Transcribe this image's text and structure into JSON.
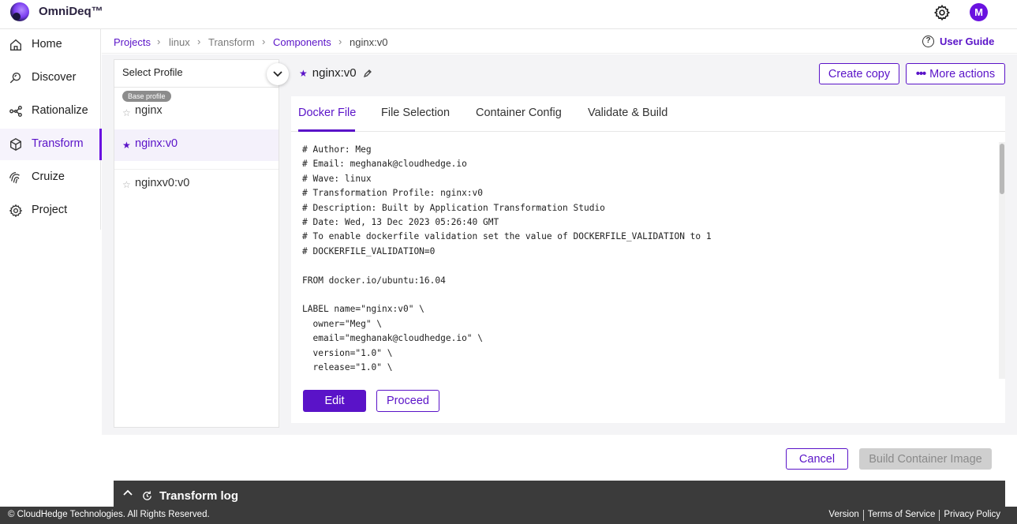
{
  "app": {
    "title": "OmniDeq™",
    "avatar_initial": "M"
  },
  "sidebar": {
    "items": [
      {
        "label": "Home",
        "icon": "home-icon"
      },
      {
        "label": "Discover",
        "icon": "discover-icon"
      },
      {
        "label": "Rationalize",
        "icon": "rationalize-icon"
      },
      {
        "label": "Transform",
        "icon": "cube-icon",
        "active": true
      },
      {
        "label": "Cruize",
        "icon": "fingerprint-icon"
      },
      {
        "label": "Project",
        "icon": "gear-icon"
      }
    ]
  },
  "breadcrumb": {
    "items": [
      "Projects",
      "linux",
      "Transform",
      "Components",
      "nginx:v0"
    ]
  },
  "user_guide": "User Guide",
  "profile_panel": {
    "header": "Select Profile",
    "base_badge": "Base profile",
    "profiles": [
      {
        "name": "nginx",
        "starred": false
      },
      {
        "name": "nginx:v0",
        "starred": true,
        "selected": true
      },
      {
        "name": "nginxv0:v0",
        "starred": false
      }
    ]
  },
  "detail": {
    "title": "nginx:v0",
    "create_copy": "Create copy",
    "more_actions": "More actions"
  },
  "tabs": [
    "Docker File",
    "File Selection",
    "Container Config",
    "Validate & Build"
  ],
  "dockerfile": {
    "lines": [
      "# Author: Meg",
      "# Email: meghanak@cloudhedge.io",
      "# Wave: linux",
      "# Transformation Profile: nginx:v0",
      "# Description: Built by Application Transformation Studio",
      "# Date: Wed, 13 Dec 2023 05:26:40 GMT",
      "# To enable dockerfile validation set the value of DOCKERFILE_VALIDATION to 1",
      "# DOCKERFILE_VALIDATION=0",
      "",
      "FROM docker.io/ubuntu:16.04",
      "",
      "LABEL name=\"nginx:v0\" \\",
      "  owner=\"Meg\" \\",
      "  email=\"meghanak@cloudhedge.io\" \\",
      "  version=\"1.0\" \\",
      "  release=\"1.0\" \\"
    ]
  },
  "actions": {
    "edit": "Edit",
    "proceed": "Proceed",
    "cancel": "Cancel",
    "build": "Build Container Image"
  },
  "log": {
    "title": "Transform log"
  },
  "footer": {
    "copyright": "© CloudHedge Technologies. All Rights Reserved.",
    "links": [
      "Version",
      "Terms of Service",
      "Privacy Policy"
    ]
  },
  "colors": {
    "accent": "#5a13c8",
    "avatar": "#6a12e0",
    "footer_bg": "#3b3b3b"
  }
}
